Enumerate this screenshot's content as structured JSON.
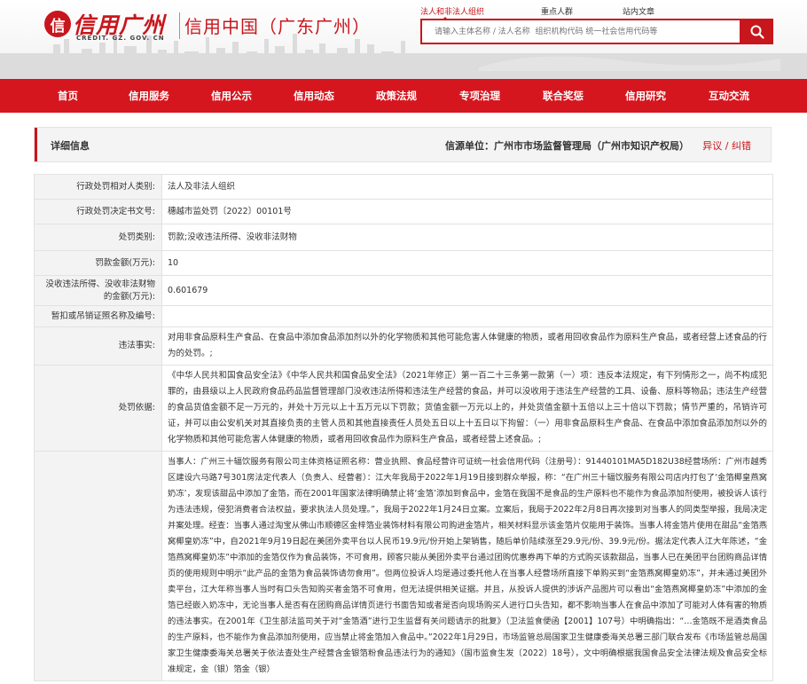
{
  "site": {
    "logo_mark": "信",
    "logo_title": "信用广州",
    "logo_domain": "CREDIT. GZ. GOV. CN",
    "logo_sub": "信用中国（广东广州）"
  },
  "search": {
    "tabs": [
      "法人和非法人组织",
      "重点人群",
      "站内文章"
    ],
    "placeholder": "请输入主体名称 / 法人名称  组织机构代码 统一社会信用代码等"
  },
  "nav": {
    "items": [
      "首页",
      "信用服务",
      "信用公示",
      "信用动态",
      "政策法规",
      "专项治理",
      "联合奖惩",
      "信用研究",
      "互动交流"
    ]
  },
  "panel": {
    "title": "详细信息",
    "source": "信源单位：广州市市场监督管理局（广州市知识产权局）",
    "link": "异议 / 纠错"
  },
  "detail": {
    "rows": [
      {
        "label": "行政处罚相对人类别:",
        "value": "法人及非法人组织"
      },
      {
        "label": "行政处罚决定书文号:",
        "value": "穗越市监处罚〔2022〕00101号"
      },
      {
        "label": "处罚类别:",
        "value": "罚款;没收违法所得、没收非法财物"
      },
      {
        "label": "罚款金额(万元):",
        "value": "10"
      },
      {
        "label": "没收违法所得、没收非法财物的金额(万元):",
        "value": "0.601679"
      },
      {
        "label": "暂扣或吊销证照名称及编号:",
        "value": ""
      },
      {
        "label": "违法事实:",
        "value": "对用非食品原料生产食品、在食品中添加食品添加剂以外的化学物质和其他可能危害人体健康的物质，或者用回收食品作为原料生产食品，或者经营上述食品的行为的处罚。;"
      },
      {
        "label": "处罚依据:",
        "value": "《中华人民共和国食品安全法》《中华人民共和国食品安全法》（2021年修正）第一百二十三条第一款第（一）项：违反本法规定，有下列情形之一，尚不构成犯罪的，由县级以上人民政府食品药品监督管理部门没收违法所得和违法生产经营的食品，并可以没收用于违法生产经营的工具、设备、原料等物品；违法生产经营的食品货值金额不足一万元的，并处十万元以上十五万元以下罚款；货值金额一万元以上的，并处货值金额十五倍以上三十倍以下罚款；情节严重的，吊销许可证，并可以由公安机关对其直接负责的主管人员和其他直接责任人员处五日以上十五日以下拘留：（一）用非食品原料生产食品、在食品中添加食品添加剂以外的化学物质和其他可能危害人体健康的物质，或者用回收食品作为原料生产食品，或者经营上述食品。;"
      },
      {
        "label": "",
        "value": "当事人：广州三十辐饮服务有限公司主体资格证照名称：营业执照、食品经营许可证统一社会信用代码（注册号）：91440101MA5D182U38经营场所：广州市越秀区建设六马路7号301房法定代表人（负责人、经营者）：江大年我局于2022年1月19日接到群众举报，称：“在广州三十辐饮服务有限公司店内打包了‘金箔椰皇燕窝奶冻’，发现该甜品中添加了金箔，而在2001年国家法律明确禁止将‘金箔’添加到食品中，金箔在我国不是食品的生产原料也不能作为食品添加剂使用，被投诉人该行为违法违规，侵犯消费者合法权益，要求执法人员处理。”，我局于2022年1月24日立案。立案后，我局于2022年2月8日再次接到对当事人的同类型举报，我局决定并案处理。经查：当事人通过淘宝从佛山市顺德区金梓箔业装饰材料有限公司购进金箔片，相关材料显示该金箔片仅能用于装饰。当事人将金箔片使用在甜品“金箔燕窝椰皇奶冻”中，自2021年9月19日起在美团外卖平台以人民币19.9元/份开始上架销售，随后单价陆续涨至29.9元/份、39.9元/份。据法定代表人江大年陈述，“金箔燕窝椰皇奶冻”中添加的金箔仅作为食品装饰，不可食用，顾客只能从美团外卖平台通过团购优惠券再下单的方式购买该款甜品，当事人已在美团平台团购商品详情页的使用规则中明示“此产品的金箔为食品装饰请勿食用”。但两位投诉人均是通过委托他人在当事人经营场所直接下单购买到“金箔燕窝椰皇奶冻”，并未通过美团外卖平台，江大年称当事人当时有口头告知购买者金箔不可食用，但无法提供相关证据。并且，从投诉人提供的涉诉产品图片可以看出“金箔燕窝椰皇奶冻”中添加的金箔已经嵌入奶冻中，无论当事人是否有在团购商品详情页进行书面告知或者是否向现场购买人进行口头告知，都不影响当事人在食品中添加了可能对人体有害的物质的违法事实。在2001年《卫生部法监司关于对“金箔酒”进行卫生监督有关问题请示的批复》（卫法监食便函【2001】107号）中明确指出：“…金箔既不是酒类食品的生产原料，也不能作为食品添加剂使用，应当禁止将金箔加入食品中。”2022年1月29日，市场监管总局国家卫生健康委海关总署三部门联合发布《市场监管总局国家卫生健康委海关总署关于依法查处生产经营含金银箔粉食品违法行为的通知》（国市监食生发〔2022〕18号），文中明确根据我国食品安全法律法规及食品安全标准规定，金（银）箔金（银）"
      }
    ]
  }
}
